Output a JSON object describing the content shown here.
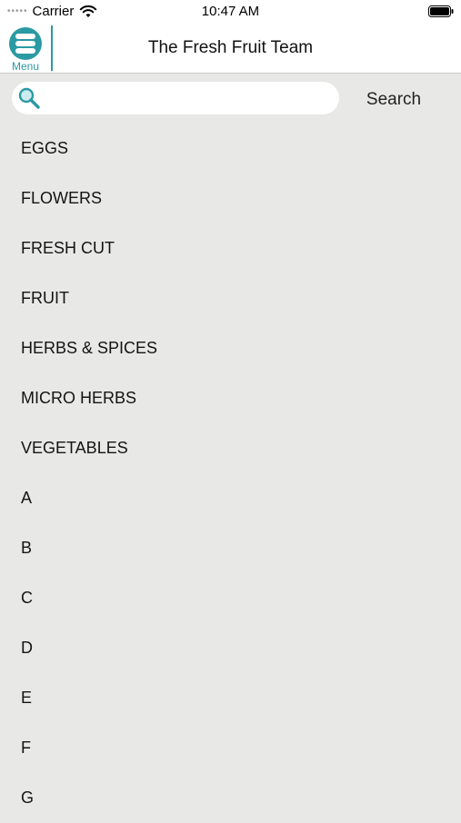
{
  "status_bar": {
    "carrier": "Carrier",
    "time": "10:47 AM"
  },
  "navbar": {
    "menu_label": "Menu",
    "title": "The Fresh Fruit Team"
  },
  "search": {
    "placeholder": "",
    "value": "",
    "button_label": "Search"
  },
  "categories": [
    "EGGS",
    "FLOWERS",
    "FRESH CUT",
    "FRUIT",
    "HERBS & SPICES",
    "MICRO HERBS",
    "VEGETABLES",
    "A",
    "B",
    "C",
    "D",
    "E",
    "F",
    "G"
  ],
  "colors": {
    "accent": "#2a9aa3",
    "background": "#e8e8e6"
  },
  "icons": {
    "menu": "menu-icon",
    "search": "search-icon",
    "wifi": "wifi-icon",
    "battery": "battery-icon"
  }
}
